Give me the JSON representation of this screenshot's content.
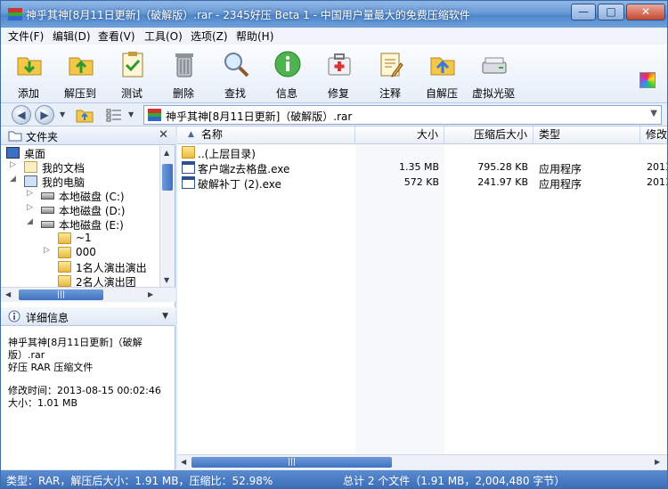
{
  "window": {
    "title": "神乎其神[8月11日更新]（破解版）.rar - 2345好压 Beta 1 - 中国用户量最大的免费压缩软件",
    "controls": {
      "minimize": "—",
      "maximize": "□",
      "close": "✕"
    }
  },
  "menu": [
    "文件(F)",
    "编辑(D)",
    "查看(V)",
    "工具(O)",
    "选项(Z)",
    "帮助(H)"
  ],
  "toolbar": [
    {
      "label": "添加",
      "icon": "add-archive-icon"
    },
    {
      "label": "解压到",
      "icon": "extract-to-icon"
    },
    {
      "label": "测试",
      "icon": "test-icon"
    },
    {
      "label": "删除",
      "icon": "delete-icon"
    },
    {
      "label": "查找",
      "icon": "find-icon"
    },
    {
      "label": "信息",
      "icon": "info-icon"
    },
    {
      "label": "修复",
      "icon": "repair-icon"
    },
    {
      "label": "注释",
      "icon": "comment-icon"
    },
    {
      "label": "自解压",
      "icon": "sfx-icon"
    },
    {
      "label": "虚拟光驱",
      "icon": "virtual-drive-icon"
    }
  ],
  "address": {
    "path": "神乎其神[8月11日更新]（破解版）.rar"
  },
  "folders_pane": {
    "title": "文件夹",
    "tree": [
      {
        "label": "桌面"
      },
      {
        "label": "我的文档"
      },
      {
        "label": "我的电脑"
      },
      {
        "label": "本地磁盘 (C:)"
      },
      {
        "label": "本地磁盘 (D:)"
      },
      {
        "label": "本地磁盘 (E:)"
      },
      {
        "label": "~1"
      },
      {
        "label": "000"
      },
      {
        "label": "1名人演出演出"
      },
      {
        "label": "2名人演出团"
      }
    ]
  },
  "details_pane": {
    "title": "详细信息",
    "line1": "神乎其神[8月11日更新]（破解",
    "line2": "版）.rar",
    "type": "好压 RAR 压缩文件",
    "modified_label": "修改时间：",
    "modified_value": "2013-08-15 00:02:46",
    "size_label": "大小：",
    "size_value": "1.01 MB"
  },
  "file_list": {
    "columns": [
      "名称",
      "大小",
      "压缩后大小",
      "类型",
      "修改"
    ],
    "rows": [
      {
        "name": "..(上层目录)",
        "size": "",
        "packed": "",
        "type": "",
        "modified": ""
      },
      {
        "name": "客户端z去格盘.exe",
        "size": "1.35 MB",
        "packed": "795.28 KB",
        "type": "应用程序",
        "modified": "2013"
      },
      {
        "name": "破解补丁 (2).exe",
        "size": "572 KB",
        "packed": "241.97 KB",
        "type": "应用程序",
        "modified": "2013"
      }
    ]
  },
  "status": {
    "left": "类型：RAR，解压后大小：1.91 MB，压缩比：52.98%",
    "right": "总计 2 个文件（1.91 MB，2,004,480 字节）"
  },
  "colors": {
    "title_bar": "#4f86cc",
    "status_bar": "#3c6fb9",
    "selection": "#dde8f6"
  }
}
